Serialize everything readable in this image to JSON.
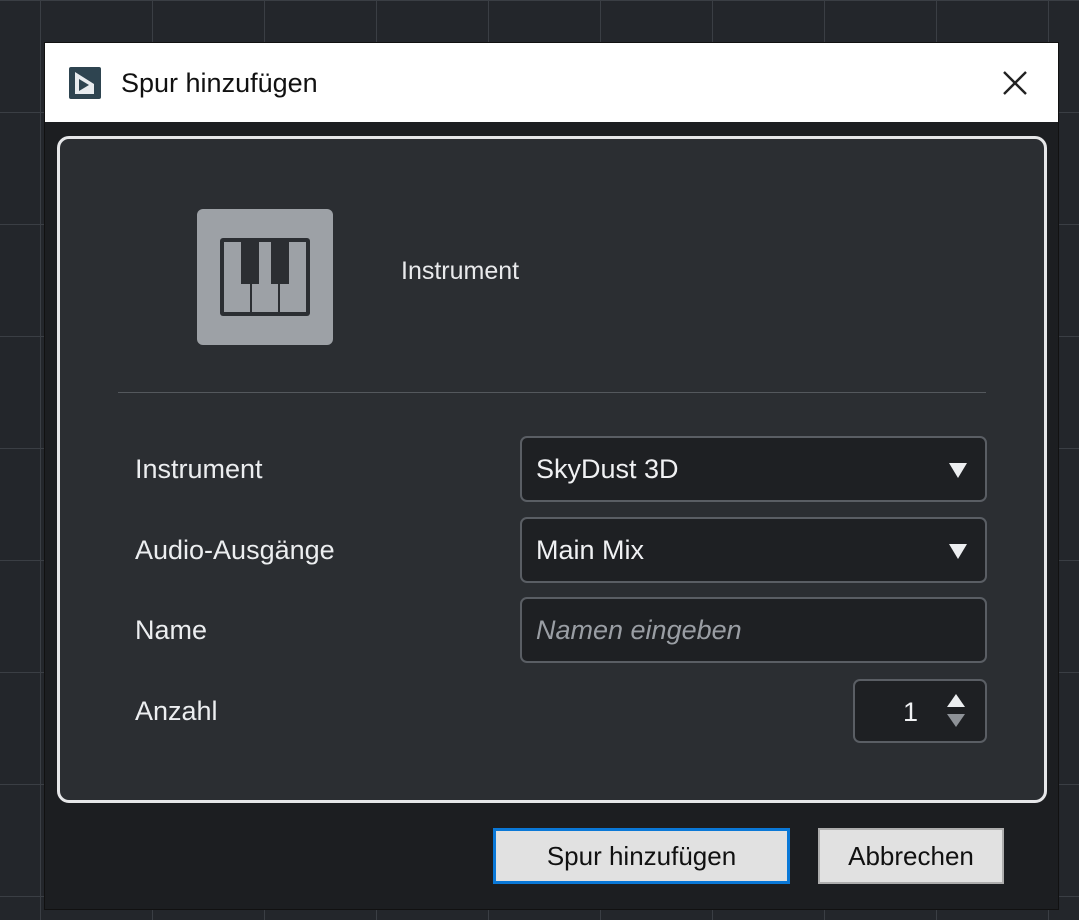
{
  "window": {
    "title": "Spur hinzufügen",
    "app_icon": "studio-one-icon",
    "close_icon": "close-icon"
  },
  "track_type": {
    "icon": "piano-keys-icon",
    "label": "Instrument"
  },
  "form": {
    "instrument": {
      "label": "Instrument",
      "value": "SkyDust 3D"
    },
    "audio_outputs": {
      "label": "Audio-Ausgänge",
      "value": "Main Mix"
    },
    "name": {
      "label": "Name",
      "value": "",
      "placeholder": "Namen eingeben"
    },
    "count": {
      "label": "Anzahl",
      "value": "1"
    }
  },
  "buttons": {
    "add_track": "Spur hinzufügen",
    "cancel": "Abbrechen"
  },
  "colors": {
    "accent": "#0a78d7",
    "panel_bg": "#2b2e32",
    "dialog_bg": "#1c1e21"
  }
}
